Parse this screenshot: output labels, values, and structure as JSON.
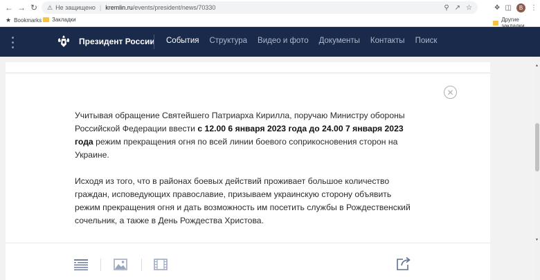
{
  "browser": {
    "security_label": "Не защищено",
    "url_host": "kremlin.ru",
    "url_path": "/events/president/news/70330",
    "avatar_letter": "B"
  },
  "bookmarks_bar": {
    "items": [
      "Bookmarks",
      "Закладки"
    ],
    "other": "Другие закладки"
  },
  "header": {
    "site_name": "Президент России",
    "nav": [
      "События",
      "Структура",
      "Видео и фото",
      "Документы",
      "Контакты",
      "Поиск"
    ],
    "active_index": 0
  },
  "article": {
    "p1_before": "Учитывая обращение Святейшего Патриарха Кирилла, поручаю Министру обороны Российской Федерации ввести ",
    "p1_bold": "с 12.00 6 января 2023 года до 24.00 7 января 2023 года",
    "p1_after": " режим прекращения огня по всей линии боевого соприкосновения сторон на Украине.",
    "p2": "Исходя из того, что в районах боевых действий проживает большое количество граждан, исповедующих православие, призываем украинскую сторону объявить режим прекращения огня и дать возможность им посетить службы в Рождественский сочельник, а также в День Рождества Христова."
  },
  "colors": {
    "header_bg": "#1a2a4a",
    "nav_inactive": "#aeb8cc",
    "icon_blue": "#6f7f9f"
  },
  "icons": [
    "back-arrow-icon",
    "forward-arrow-icon",
    "reload-icon",
    "warning-icon",
    "zoom-icon",
    "share-icon",
    "star-icon",
    "extensions-icon",
    "sidepanel-icon",
    "kebab-icon",
    "emblem-icon",
    "close-icon",
    "text-view-icon",
    "image-view-icon",
    "video-view-icon",
    "share-out-icon"
  ]
}
